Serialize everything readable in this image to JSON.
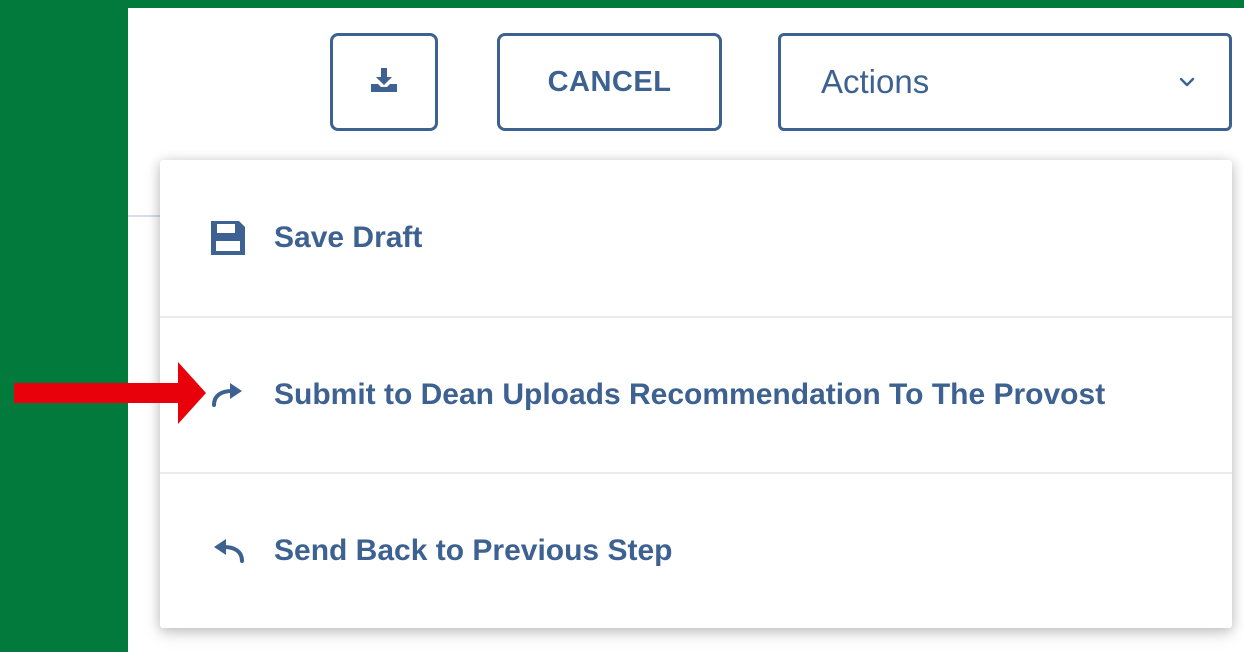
{
  "toolbar": {
    "download_icon": "download-icon",
    "cancel_label": "CANCEL",
    "actions_label": "Actions",
    "actions_chevron_icon": "chevron-down-icon"
  },
  "actions_menu": {
    "items": [
      {
        "label": "Save Draft",
        "icon": "save-icon"
      },
      {
        "label": "Submit to Dean Uploads Recommendation To The Provost",
        "icon": "forward-arrow-icon"
      },
      {
        "label": "Send Back to Previous Step",
        "icon": "undo-arrow-icon"
      }
    ]
  },
  "annotation": {
    "pointer_icon": "red-arrow-icon",
    "color": "#e8000b"
  },
  "colors": {
    "background": "#017a3b",
    "accent": "#3d6291",
    "panel": "#ffffff"
  }
}
